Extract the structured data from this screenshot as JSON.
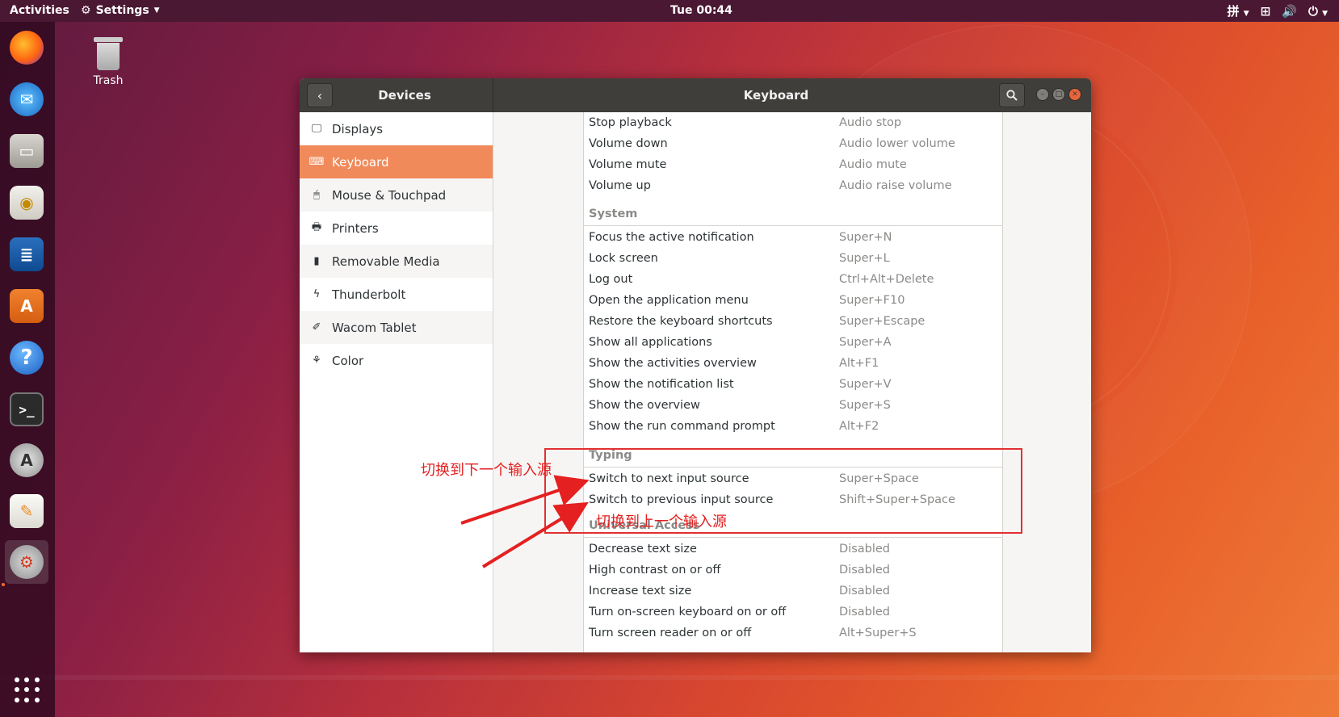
{
  "topbar": {
    "activities": "Activities",
    "app_menu": "Settings",
    "clock": "Tue 00:44",
    "input_indicator": "拼"
  },
  "desktop": {
    "trash_label": "Trash"
  },
  "dock": {
    "items": [
      "firefox-icon",
      "thunderbird-icon",
      "files-icon",
      "rhythmbox-icon",
      "writer-icon",
      "software-icon",
      "help-icon",
      "terminal-icon",
      "software-updater-icon",
      "text-editor-icon",
      "settings-icon"
    ],
    "active": "settings-icon"
  },
  "window": {
    "left_title": "Devices",
    "right_title": "Keyboard"
  },
  "sidebar": {
    "items": [
      {
        "label": "Displays",
        "icon": "display-icon"
      },
      {
        "label": "Keyboard",
        "icon": "keyboard-icon",
        "selected": true
      },
      {
        "label": "Mouse & Touchpad",
        "icon": "mouse-icon"
      },
      {
        "label": "Printers",
        "icon": "printer-icon"
      },
      {
        "label": "Removable Media",
        "icon": "usb-icon"
      },
      {
        "label": "Thunderbolt",
        "icon": "thunderbolt-icon"
      },
      {
        "label": "Wacom Tablet",
        "icon": "tablet-icon"
      },
      {
        "label": "Color",
        "icon": "color-icon"
      }
    ]
  },
  "shortcuts": {
    "sound_rows": [
      {
        "name": "Stop playback",
        "accel": "Audio stop"
      },
      {
        "name": "Volume down",
        "accel": "Audio lower volume"
      },
      {
        "name": "Volume mute",
        "accel": "Audio mute"
      },
      {
        "name": "Volume up",
        "accel": "Audio raise volume"
      }
    ],
    "system": {
      "title": "System",
      "rows": [
        {
          "name": "Focus the active notification",
          "accel": "Super+N"
        },
        {
          "name": "Lock screen",
          "accel": "Super+L"
        },
        {
          "name": "Log out",
          "accel": "Ctrl+Alt+Delete"
        },
        {
          "name": "Open the application menu",
          "accel": "Super+F10"
        },
        {
          "name": "Restore the keyboard shortcuts",
          "accel": "Super+Escape"
        },
        {
          "name": "Show all applications",
          "accel": "Super+A"
        },
        {
          "name": "Show the activities overview",
          "accel": "Alt+F1"
        },
        {
          "name": "Show the notification list",
          "accel": "Super+V"
        },
        {
          "name": "Show the overview",
          "accel": "Super+S"
        },
        {
          "name": "Show the run command prompt",
          "accel": "Alt+F2"
        }
      ]
    },
    "typing": {
      "title": "Typing",
      "rows": [
        {
          "name": "Switch to next input source",
          "accel": "Super+Space"
        },
        {
          "name": "Switch to previous input source",
          "accel": "Shift+Super+Space"
        }
      ]
    },
    "universal_access": {
      "title": "Universal Access",
      "rows": [
        {
          "name": "Decrease text size",
          "accel": "Disabled"
        },
        {
          "name": "High contrast on or off",
          "accel": "Disabled"
        },
        {
          "name": "Increase text size",
          "accel": "Disabled"
        },
        {
          "name": "Turn on-screen keyboard on or off",
          "accel": "Disabled"
        },
        {
          "name": "Turn screen reader on or off",
          "accel": "Alt+Super+S"
        }
      ]
    }
  },
  "annotations": {
    "next_source": "切换到下一个输入源",
    "prev_source": "切换到上一个输入源",
    "color": "#e42020"
  }
}
